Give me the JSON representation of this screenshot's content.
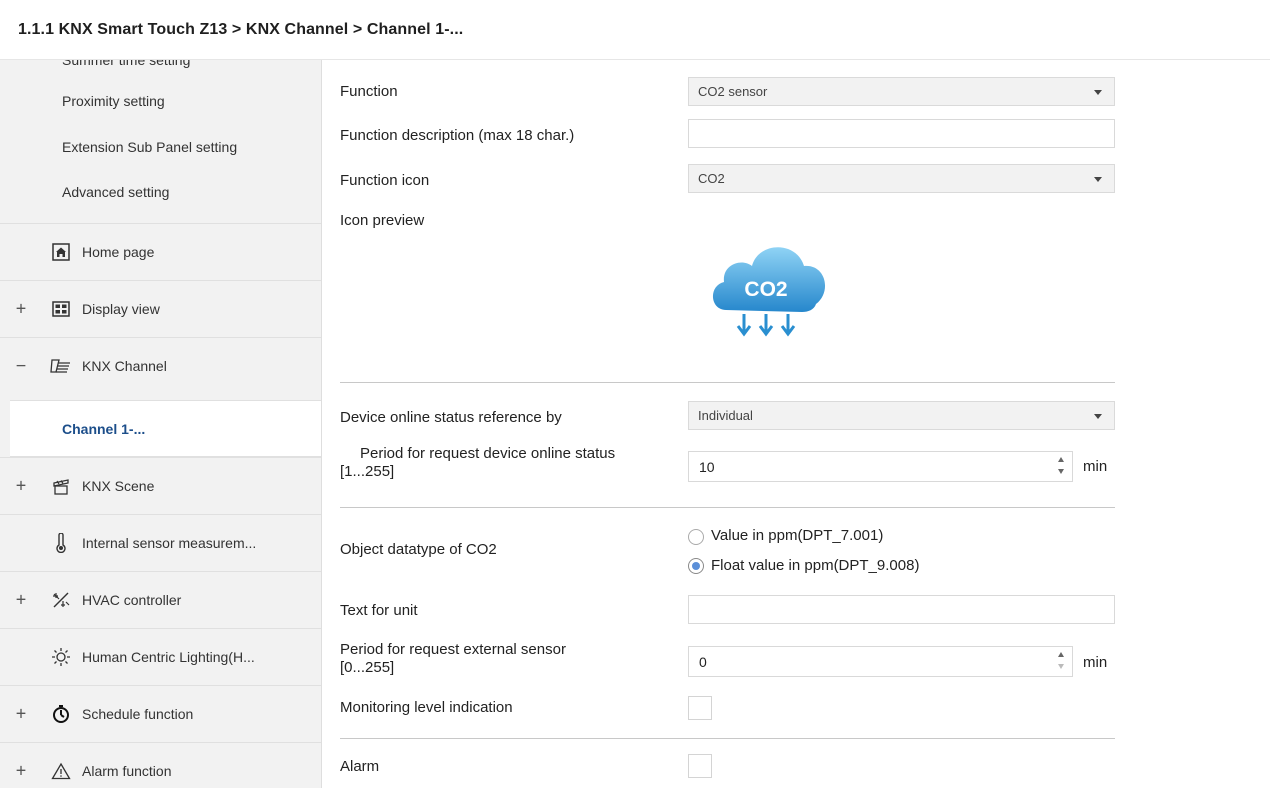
{
  "breadcrumb": "1.1.1 KNX Smart Touch Z13 > KNX Channel  > Channel 1-...",
  "sidebar": {
    "cut_item": "Summer time setting",
    "sub_items": [
      "Proximity setting",
      "Extension Sub Panel setting",
      "Advanced setting"
    ],
    "items": [
      {
        "prefix": "",
        "icon": "home-icon",
        "label": "Home page"
      },
      {
        "prefix": "+",
        "icon": "display-grid-icon",
        "label": "Display view"
      },
      {
        "prefix": "−",
        "icon": "channel-icon",
        "label": "KNX Channel"
      },
      {
        "prefix": "",
        "icon": "",
        "label": "Channel 1-..."
      },
      {
        "prefix": "+",
        "icon": "scene-icon",
        "label": "KNX Scene"
      },
      {
        "prefix": "",
        "icon": "thermometer-icon",
        "label": "Internal sensor measurem..."
      },
      {
        "prefix": "+",
        "icon": "hvac-icon",
        "label": "HVAC controller"
      },
      {
        "prefix": "",
        "icon": "sun-icon",
        "label": "Human Centric Lighting(H..."
      },
      {
        "prefix": "+",
        "icon": "timer-icon",
        "label": "Schedule function"
      },
      {
        "prefix": "+",
        "icon": "warning-icon",
        "label": "Alarm function"
      }
    ]
  },
  "form": {
    "function_label": "Function",
    "function_value": "CO2 sensor",
    "description_label": "Function description (max 18 char.)",
    "description_value": "",
    "icon_label": "Function icon",
    "icon_value": "CO2",
    "preview_label": "Icon preview",
    "preview_text": "CO2",
    "online_ref_label": "Device online status reference by",
    "online_ref_value": "Individual",
    "period_online_label_1": "Period for request device online status",
    "period_online_label_2": "[1...255]",
    "period_online_value": "10",
    "period_online_unit": "min",
    "datatype_label": "Object datatype of CO2",
    "datatype_options": [
      "Value in ppm(DPT_7.001)",
      "Float value in ppm(DPT_9.008)"
    ],
    "datatype_selected": 1,
    "unit_text_label": "Text for unit",
    "unit_text_value": "",
    "period_ext_label_1": "Period for request external sensor",
    "period_ext_label_2": "[0...255]",
    "period_ext_value": "0",
    "period_ext_unit": "min",
    "monitoring_label": "Monitoring level indication",
    "monitoring_checked": false,
    "alarm_label": "Alarm",
    "alarm_checked": false
  },
  "colors": {
    "active_label": "#1c4e8a",
    "cloud_top": "#74c6f0",
    "cloud_bottom": "#2a8fd0",
    "radio_dot": "#5b8fd8"
  }
}
